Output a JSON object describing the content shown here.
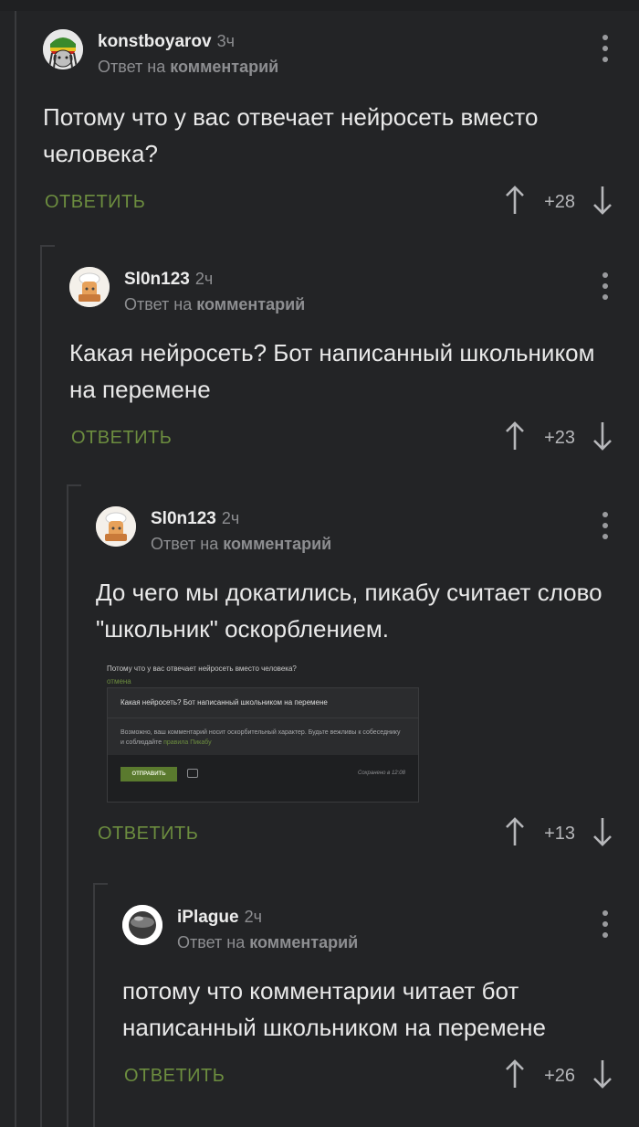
{
  "comments": [
    {
      "author": "konstboyarov",
      "time": "3ч",
      "reply_prefix": "Ответ на",
      "reply_target": "комментарий",
      "text": "Потому что у вас отвечает нейросеть вместо человека?",
      "reply_label": "ОТВЕТИТЬ",
      "score": "+28"
    },
    {
      "author": "Sl0n123",
      "time": "2ч",
      "reply_prefix": "Ответ на",
      "reply_target": "комментарий",
      "text": "Какая нейросеть? Бот написанный школьником на перемене",
      "reply_label": "ОТВЕТИТЬ",
      "score": "+23"
    },
    {
      "author": "Sl0n123",
      "time": "2ч",
      "reply_prefix": "Ответ на",
      "reply_target": "комментарий",
      "text": "До чего мы докатились, пикабу считает слово \"школьник\" оскорблением.",
      "reply_label": "ОТВЕТИТЬ",
      "score": "+13"
    },
    {
      "author": "iPlague",
      "time": "2ч",
      "reply_prefix": "Ответ на",
      "reply_target": "комментарий",
      "text": "потому что комментарии читает бот написанный школьником на перемене",
      "reply_label": "ОТВЕТИТЬ",
      "score": "+26"
    }
  ],
  "screenshot": {
    "quote": "Потому что у вас отвечает нейросеть вместо человека?",
    "cancel": "отмена",
    "input": "Какая нейросеть? Бот написанный школьником на перемене",
    "warning": "Возможно, ваш комментарий носит оскорбительный характер. Будьте вежливы к собеседнику и соблюдайте",
    "rules_link": "правила Пикабу",
    "send_button": "ОТПРАВИТЬ",
    "saved": "Сохранено в 12:08"
  },
  "colors": {
    "background": "#232426",
    "accent_green": "#6c8d3f",
    "muted": "#8d8e91"
  }
}
